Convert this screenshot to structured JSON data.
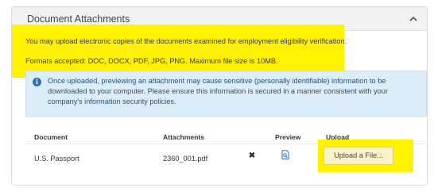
{
  "panel": {
    "title": "Document Attachments",
    "collapse_icon": "chevron-up-icon"
  },
  "notice": {
    "line1": "You may upload electronic copies of the documents examined for employment eligibility verification.",
    "line2": "Formats accepted: DOC, DOCX, PDF, JPG, PNG. Maximum file size is 10MB."
  },
  "info_alert": {
    "icon": "info-icon",
    "text": "Once uploaded, previewing an attachment may cause sensitive (personally identifiable) information to be downloaded to your computer. Please ensure this information is secured in a manner consistent with your company's information security policies."
  },
  "table": {
    "headers": {
      "document": "Document",
      "attachments": "Attachments",
      "preview": "Preview",
      "upload": "Upload"
    },
    "rows": [
      {
        "document": "U.S. Passport",
        "attachment": "2360_001.pdf",
        "remove_icon": "close-icon",
        "preview_icon": "file-preview-icon",
        "upload_label": "Upload a File..."
      }
    ]
  },
  "colors": {
    "highlight": "#fff100",
    "info_background": "#dcecf8",
    "info_icon": "#2a74b8",
    "header_background": "#f2f2f2"
  }
}
